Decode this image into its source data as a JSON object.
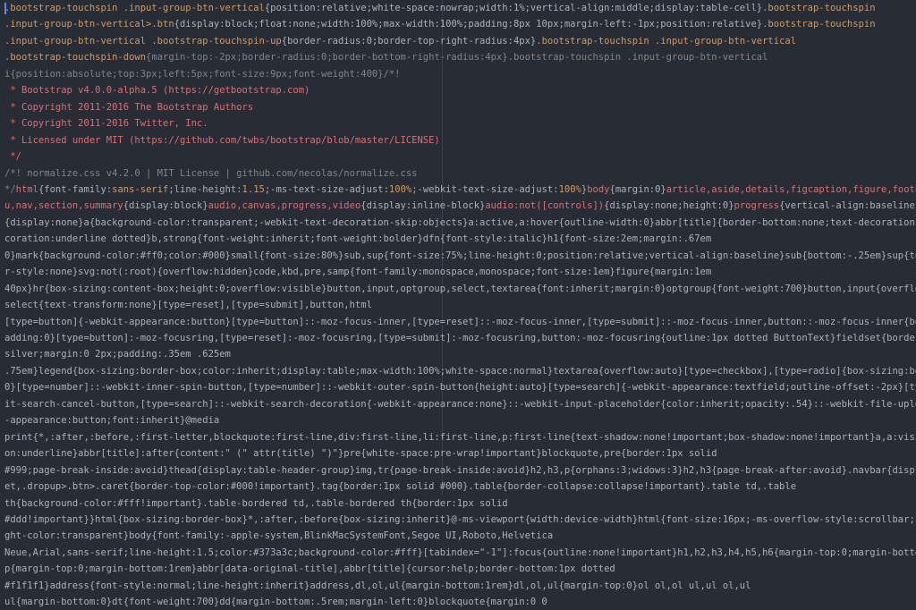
{
  "editor": {
    "lines": [
      [
        {
          "t": ".bootstrap-touchspin .input-group-btn-vertical",
          "c": "sel"
        },
        {
          "t": "{position:relative;white-space:nowrap;width:1%;vertical-align:middle;display:table-cell}",
          "c": "prop"
        },
        {
          "t": ".bootstrap-touchspin",
          "c": "sel"
        }
      ],
      [
        {
          "t": ".input-group-btn-vertical>.btn",
          "c": "sel"
        },
        {
          "t": "{display:block;float:none;width:100%;max-width:100%;padding:8px 10px;margin-left:-1px;position:relative}",
          "c": "prop"
        },
        {
          "t": ".bootstrap-touchspin",
          "c": "sel"
        }
      ],
      [
        {
          "t": ".input-group-btn-vertical .bootstrap-touchspin-up",
          "c": "sel"
        },
        {
          "t": "{border-radius:0;border-top-right-radius:4px}",
          "c": "prop"
        },
        {
          "t": ".bootstrap-touchspin .input-group-btn-vertical",
          "c": "sel"
        }
      ],
      [
        {
          "t": ".bootstrap-touchspin-down",
          "c": "sel"
        },
        {
          "t": "{margin-top:-2px;border-radius:0;border-bottom-right-radius:4px}.bootstrap-touchspin .input-group-btn-vertical",
          "c": "com"
        }
      ],
      [
        {
          "t": "i{position:absolute;top:3px;left:5px;font-size:9px;font-weight:400}/*!",
          "c": "com"
        }
      ],
      [
        {
          "t": " * Bootstrap v4.0.0-alpha.5 (https://getbootstrap.com)",
          "c": "lic"
        }
      ],
      [
        {
          "t": " * Copyright 2011-2016 The Bootstrap Authors",
          "c": "lic"
        }
      ],
      [
        {
          "t": " * Copyright 2011-2016 Twitter, Inc.",
          "c": "lic"
        }
      ],
      [
        {
          "t": " * Licensed under MIT (https://github.com/twbs/bootstrap/blob/master/LICENSE)",
          "c": "lic"
        }
      ],
      [
        {
          "t": " */",
          "c": "lic"
        }
      ],
      [
        {
          "t": "/*! normalize.css v4.2.0 | MIT License | github.com/necolas/normalize.css ",
          "c": "com"
        }
      ],
      [
        {
          "t": "*/",
          "c": "com"
        },
        {
          "t": "html",
          "c": "tag"
        },
        {
          "t": "{font-family:",
          "c": "prop"
        },
        {
          "t": "sans-serif",
          "c": "sel"
        },
        {
          "t": ";line-height:",
          "c": "prop"
        },
        {
          "t": "1.15",
          "c": "sel"
        },
        {
          "t": ";-ms-text-size-adjust:",
          "c": "prop"
        },
        {
          "t": "100%",
          "c": "sel"
        },
        {
          "t": ";-webkit-text-size-adjust:",
          "c": "prop"
        },
        {
          "t": "100%",
          "c": "sel"
        },
        {
          "t": "}",
          "c": "prop"
        },
        {
          "t": "body",
          "c": "tag"
        },
        {
          "t": "{margin:0}",
          "c": "prop"
        },
        {
          "t": "article,aside,details,figcaption,figure,footer,hea",
          "c": "tag"
        }
      ],
      [
        {
          "t": "u,nav,section,summary",
          "c": "tag"
        },
        {
          "t": "{display:block}",
          "c": "prop"
        },
        {
          "t": "audio,canvas,progress,video",
          "c": "tag"
        },
        {
          "t": "{display:inline-block}",
          "c": "prop"
        },
        {
          "t": "audio:not([controls])",
          "c": "tag"
        },
        {
          "t": "{display:none;height:0}",
          "c": "prop"
        },
        {
          "t": "progress",
          "c": "tag"
        },
        {
          "t": "{vertical-align:baseline}",
          "c": "prop"
        },
        {
          "t": "[hidd",
          "c": "tag"
        }
      ],
      [
        {
          "t": "{display:none}a{background-color:transparent;-webkit-text-decoration-skip:objects}a:active,a:hover{outline-width:0}abbr[title]{border-bottom:none;text-decoration:under",
          "c": "prop"
        }
      ],
      [
        {
          "t": "coration:underline dotted}b,strong{font-weight:inherit;font-weight:bolder}dfn{font-style:italic}h1{font-size:2em;margin:.67em",
          "c": "prop"
        }
      ],
      [
        {
          "t": "0}mark{background-color:#ff0;color:#000}small{font-size:80%}sub,sup{font-size:75%;line-height:0;position:relative;vertical-align:baseline}sub{bottom:-.25em}sup{top:-.5",
          "c": "prop"
        }
      ],
      [
        {
          "t": "r-style:none}svg:not(:root){overflow:hidden}code,kbd,pre,samp{font-family:monospace,monospace;font-size:1em}figure{margin:1em",
          "c": "prop"
        }
      ],
      [
        {
          "t": "40px}hr{box-sizing:content-box;height:0;overflow:visible}button,input,optgroup,select,textarea{font:inherit;margin:0}optgroup{font-weight:700}button,input{overflow:vis",
          "c": "prop"
        }
      ],
      [
        {
          "t": "select{text-transform:none}[type=reset],[type=submit],button,html",
          "c": "prop"
        }
      ],
      [
        {
          "t": "[type=button]{-webkit-appearance:button}[type=button]::-moz-focus-inner,[type=reset]::-moz-focus-inner,[type=submit]::-moz-focus-inner,button::-moz-focus-inner{border-",
          "c": "prop"
        }
      ],
      [
        {
          "t": "adding:0}[type=button]:-moz-focusring,[type=reset]:-moz-focusring,[type=submit]:-moz-focusring,button:-moz-focusring{outline:1px dotted ButtonText}fieldset{border:1px",
          "c": "prop"
        }
      ],
      [
        {
          "t": "silver;margin:0 2px;padding:.35em .625em",
          "c": "prop"
        }
      ],
      [
        {
          "t": ".75em}legend{box-sizing:border-box;color:inherit;display:table;max-width:100%;white-space:normal}textarea{overflow:auto}[type=checkbox],[type=radio]{box-sizing:border-",
          "c": "prop"
        }
      ],
      [
        {
          "t": "0}[type=number]::-webkit-inner-spin-button,[type=number]::-webkit-outer-spin-button{height:auto}[type=search]{-webkit-appearance:textfield;outline-offset:-2px}[type=se",
          "c": "prop"
        }
      ],
      [
        {
          "t": "it-search-cancel-button,[type=search]::-webkit-search-decoration{-webkit-appearance:none}::-webkit-input-placeholder{color:inherit;opacity:.54}::-webkit-file-upload-bu",
          "c": "prop"
        }
      ],
      [
        {
          "t": "-appearance:button;font:inherit}@media",
          "c": "prop"
        }
      ],
      [
        {
          "t": "print{*,:after,:before,:first-letter,blockquote:first-line,div:first-line,li:first-line,p:first-line{text-shadow:none!important;box-shadow:none!important}a,a:visited{te",
          "c": "prop"
        }
      ],
      [
        {
          "t": "on:underline}abbr[title]:after{content:\" (\" attr(title) \")\"}pre{white-space:pre-wrap!important}blockquote,pre{border:1px solid",
          "c": "prop"
        }
      ],
      [
        {
          "t": "#999;page-break-inside:avoid}thead{display:table-header-group}img,tr{page-break-inside:avoid}h2,h3,p{orphans:3;widows:3}h2,h3{page-break-after:avoid}.navbar{display:no",
          "c": "prop"
        }
      ],
      [
        {
          "t": "et,.dropup>.btn>.caret{border-top-color:#000!important}.tag{border:1px solid #000}.table{border-collapse:collapse!important}.table td,.table",
          "c": "prop"
        }
      ],
      [
        {
          "t": "th{background-color:#fff!important}.table-bordered td,.table-bordered th{border:1px solid",
          "c": "prop"
        }
      ],
      [
        {
          "t": "#ddd!important}}html{box-sizing:border-box}*,:after,:before{box-sizing:inherit}@-ms-viewport{width:device-width}html{font-size:16px;-ms-overflow-style:scrollbar;-webki",
          "c": "prop"
        }
      ],
      [
        {
          "t": "ght-color:transparent}body{font-family:-apple-system,BlinkMacSystemFont,Segoe UI,Roboto,Helvetica",
          "c": "prop"
        }
      ],
      [
        {
          "t": "Neue,Arial,sans-serif;line-height:1.5;color:#373a3c;background-color:#fff}[tabindex=\"-1\"]:focus{outline:none!important}h1,h2,h3,h4,h5,h6{margin-top:0;margin-bottom:.5r",
          "c": "prop"
        }
      ],
      [
        {
          "t": "p{margin-top:0;margin-bottom:1rem}abbr[data-original-title],abbr[title]{cursor:help;border-bottom:1px dotted",
          "c": "prop"
        }
      ],
      [
        {
          "t": "#f1f1f1}address{font-style:normal;line-height:inherit}address,dl,ol,ul{margin-bottom:1rem}dl,ol,ul{margin-top:0}ol ol,ol ul,ul ol,ul",
          "c": "prop"
        }
      ],
      [
        {
          "t": "ul{margin-bottom:0}dt{font-weight:700}dd{margin-bottom:.5rem;margin-left:0}blockquote{margin:0 0",
          "c": "prop"
        }
      ]
    ]
  }
}
